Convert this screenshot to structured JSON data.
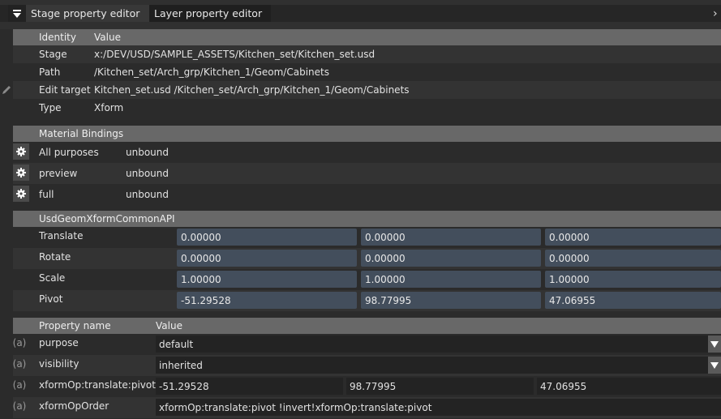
{
  "tabs": [
    {
      "label": "Stage property editor",
      "active": true
    },
    {
      "label": "Layer property editor",
      "active": false
    }
  ],
  "identity": {
    "header": {
      "col1": "Identity",
      "col2": "Value"
    },
    "rows": [
      {
        "label": "Stage",
        "value": "x:/DEV/USD/SAMPLE_ASSETS/Kitchen_set/Kitchen_set.usd"
      },
      {
        "label": "Path",
        "value": "/Kitchen_set/Arch_grp/Kitchen_1/Geom/Cabinets"
      },
      {
        "label": "Edit target",
        "value": "Kitchen_set.usd /Kitchen_set/Arch_grp/Kitchen_1/Geom/Cabinets",
        "icon": "pencil-icon"
      },
      {
        "label": "Type",
        "value": "Xform"
      }
    ]
  },
  "material_bindings": {
    "header": "Material Bindings",
    "rows": [
      {
        "label": "All purposes",
        "value": "unbound"
      },
      {
        "label": "preview",
        "value": "unbound"
      },
      {
        "label": "full",
        "value": "unbound"
      }
    ]
  },
  "xform_api": {
    "header": "UsdGeomXformCommonAPI",
    "rows": [
      {
        "label": "Translate",
        "values": [
          "0.00000",
          "0.00000",
          "0.00000"
        ]
      },
      {
        "label": "Rotate",
        "values": [
          "0.00000",
          "0.00000",
          "0.00000"
        ]
      },
      {
        "label": "Scale",
        "values": [
          "1.00000",
          "1.00000",
          "1.00000"
        ]
      },
      {
        "label": "Pivot",
        "values": [
          "-51.29528",
          "98.77995",
          "47.06955"
        ]
      }
    ]
  },
  "properties": {
    "header": {
      "col1": "Property name",
      "col2": "Value"
    },
    "attr_marker": "(a)",
    "purpose": {
      "label": "purpose",
      "value": "default"
    },
    "visibility": {
      "label": "visibility",
      "value": "inherited"
    },
    "pivot": {
      "label": "xformOp:translate:pivot",
      "values": [
        "-51.29528",
        "98.77995",
        "47.06955"
      ]
    },
    "op_order": {
      "label": "xformOpOrder",
      "value": "xformOp:translate:pivot !invert!xformOp:translate:pivot"
    }
  }
}
